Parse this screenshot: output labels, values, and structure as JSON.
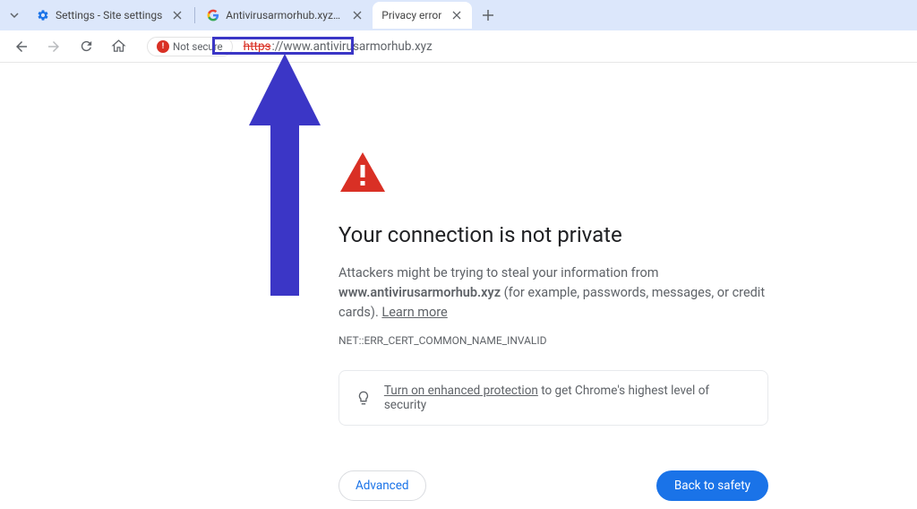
{
  "tabs": [
    {
      "title": "Settings - Site settings",
      "favicon": "settings"
    },
    {
      "title": "Antivirusarmorhub.xyz - Google",
      "favicon": "google"
    },
    {
      "title": "Privacy error",
      "favicon": "none",
      "active": true
    }
  ],
  "toolbar": {
    "not_secure_label": "Not secure",
    "url_protocol": "https",
    "url_rest": "://www.antivirusarmorhub.xyz"
  },
  "page": {
    "heading": "Your connection is not private",
    "body_prefix": "Attackers might be trying to steal your information from ",
    "body_domain": "www.antivirusarmorhub.xyz",
    "body_suffix": " (for example, passwords, messages, or credit cards). ",
    "learn_more": "Learn more",
    "error_code": "NET::ERR_CERT_COMMON_NAME_INVALID",
    "tip_link": "Turn on enhanced protection",
    "tip_rest": " to get Chrome's highest level of security",
    "advanced_label": "Advanced",
    "safety_label": "Back to safety"
  }
}
